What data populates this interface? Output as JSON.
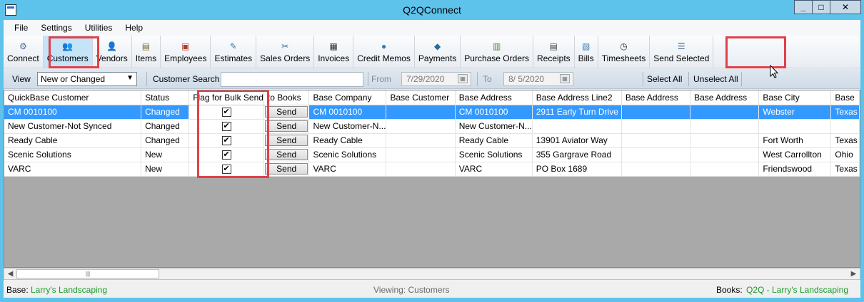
{
  "window": {
    "title": "Q2QConnect"
  },
  "menu": [
    "File",
    "Settings",
    "Utilities",
    "Help"
  ],
  "toolbar": [
    {
      "label": "Connect",
      "icon": "connect-icon",
      "glyph": "⚙",
      "color": "#4a6a9a"
    },
    {
      "label": "Customers",
      "icon": "customers-icon",
      "glyph": "👥",
      "color": "#d0602a"
    },
    {
      "label": "Vendors",
      "icon": "vendors-icon",
      "glyph": "👤",
      "color": "#c08a20"
    },
    {
      "label": "Items",
      "icon": "items-icon",
      "glyph": "▤",
      "color": "#7a6a2a"
    },
    {
      "label": "Employees",
      "icon": "employees-icon",
      "glyph": "▣",
      "color": "#b03a2a"
    },
    {
      "label": "Estimates",
      "icon": "estimates-icon",
      "glyph": "✎",
      "color": "#3a7ab0"
    },
    {
      "label": "Sales Orders",
      "icon": "sales-orders-icon",
      "glyph": "✂",
      "color": "#4a6a9a"
    },
    {
      "label": "Invoices",
      "icon": "invoices-icon",
      "glyph": "▦",
      "color": "#333333"
    },
    {
      "label": "Credit Memos",
      "icon": "credit-memos-icon",
      "glyph": "●",
      "color": "#2a7ad0"
    },
    {
      "label": "Payments",
      "icon": "payments-icon",
      "glyph": "◆",
      "color": "#2a6a9a"
    },
    {
      "label": "Purchase Orders",
      "icon": "purchase-orders-icon",
      "glyph": "▥",
      "color": "#4a8a3a"
    },
    {
      "label": "Receipts",
      "icon": "receipts-icon",
      "glyph": "▤",
      "color": "#444444"
    },
    {
      "label": "Bills",
      "icon": "bills-icon",
      "glyph": "▧",
      "color": "#3a7ab0"
    },
    {
      "label": "Timesheets",
      "icon": "timesheets-icon",
      "glyph": "◷",
      "color": "#333333"
    },
    {
      "label": "Send Selected",
      "icon": "send-selected-icon",
      "glyph": "☰",
      "color": "#4a6a9a"
    }
  ],
  "filter": {
    "view_label": "View",
    "view_value": "New or Changed",
    "search_label": "Customer Search",
    "search_value": "",
    "from_label": "From",
    "from_date": "7/29/2020",
    "to_label": "To",
    "to_date": "8/ 5/2020",
    "select_all": "Select All",
    "unselect_all": "Unselect All"
  },
  "grid": {
    "columns": [
      "QuickBase Customer",
      "Status",
      "Flag for Bulk Send",
      "to Books",
      "Base Company",
      "Base Customer",
      "Base Address",
      "Base Address Line2",
      "Base Address",
      "Base Address",
      "Base City",
      "Base"
    ],
    "send_label": "Send",
    "rows": [
      {
        "customer": "CM 0010100",
        "status": "Changed",
        "flag": true,
        "company": "CM 0010100",
        "base_customer": "",
        "address": "CM 0010100",
        "address2": "2911 Early Turn Drive",
        "address3": "",
        "address4": "",
        "city": "Webster",
        "state": "Texas",
        "selected": true
      },
      {
        "customer": "New Customer-Not Synced",
        "status": "Changed",
        "flag": true,
        "company": "New Customer-N...",
        "base_customer": "",
        "address": "New Customer-N...",
        "address2": "",
        "address3": "",
        "address4": "",
        "city": "",
        "state": "",
        "selected": false
      },
      {
        "customer": "Ready Cable",
        "status": "Changed",
        "flag": true,
        "company": "Ready Cable",
        "base_customer": "",
        "address": "Ready Cable",
        "address2": "13901 Aviator Way",
        "address3": "",
        "address4": "",
        "city": "Fort Worth",
        "state": "Texas",
        "selected": false
      },
      {
        "customer": "Scenic Solutions",
        "status": "New",
        "flag": true,
        "company": "Scenic Solutions",
        "base_customer": "",
        "address": "Scenic Solutions",
        "address2": "355 Gargrave Road",
        "address3": "",
        "address4": "",
        "city": "West Carrollton",
        "state": "Ohio",
        "selected": false
      },
      {
        "customer": "VARC",
        "status": "New",
        "flag": true,
        "company": "VARC",
        "base_customer": "",
        "address": "VARC",
        "address2": "PO Box 1689",
        "address3": "",
        "address4": "",
        "city": "Friendswood",
        "state": "Texas",
        "selected": false
      }
    ]
  },
  "status": {
    "base_label": "Base:",
    "base_value": "Larry's Landscaping",
    "viewing": "Viewing: Customers",
    "books_label": "Books:",
    "books_value": "Q2Q - Larry's Landscaping"
  },
  "colors": {
    "accent": "#3399ff",
    "highlight": "#e0404a",
    "titlebar": "#5ec3ea",
    "status_green": "#1a9a2a"
  }
}
